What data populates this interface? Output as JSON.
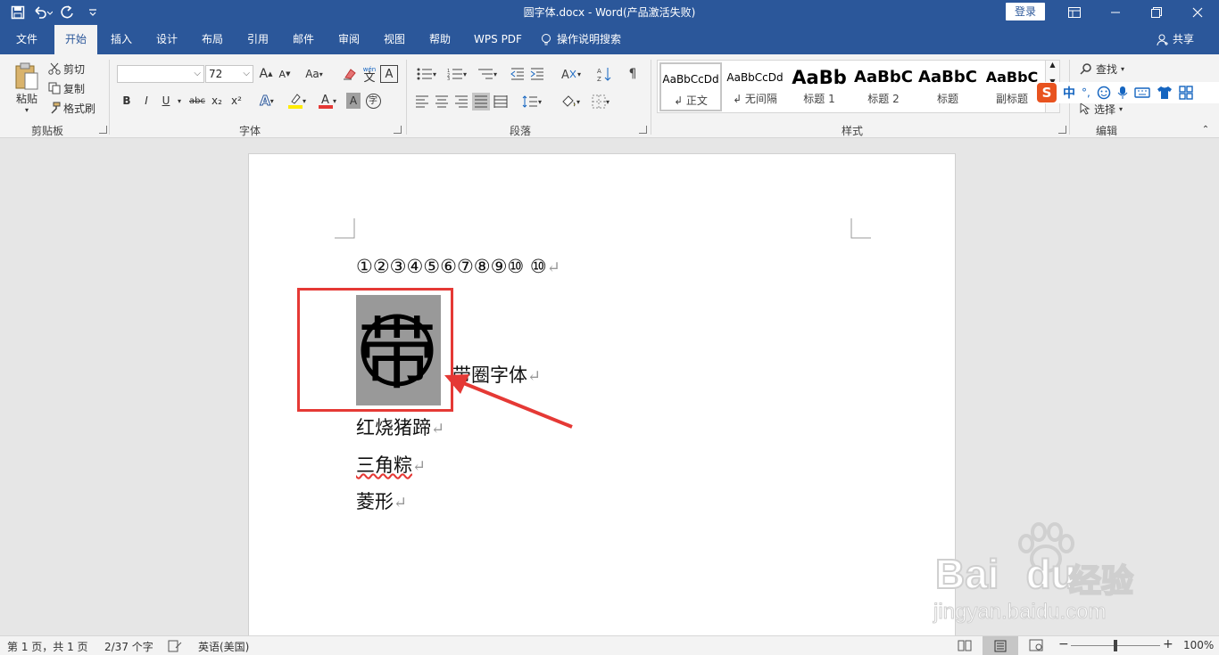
{
  "titlebar": {
    "doc_title": "圆字体.docx  -  Word(产品激活失败)",
    "login": "登录"
  },
  "tabs": [
    "文件",
    "开始",
    "插入",
    "设计",
    "布局",
    "引用",
    "邮件",
    "审阅",
    "视图",
    "帮助",
    "WPS PDF",
    "操作说明搜索"
  ],
  "share": "共享",
  "clipboard": {
    "paste": "粘贴",
    "cut": "剪切",
    "copy": "复制",
    "format_painter": "格式刷",
    "label": "剪贴板"
  },
  "font": {
    "name_value": "",
    "size_value": "72",
    "label": "字体",
    "bold": "B",
    "italic": "I",
    "underline": "U",
    "strike": "abc",
    "sub": "x₂",
    "sup": "x²",
    "wen": "wén",
    "wen_char": "文",
    "case": "Aa",
    "grow": "A",
    "shrink": "A",
    "circle_char": "字"
  },
  "paragraph": {
    "label": "段落"
  },
  "styles": {
    "label": "样式",
    "items": [
      {
        "preview": "AaBbCcDd",
        "name": "↲ 正文"
      },
      {
        "preview": "AaBbCcDd",
        "name": "↲ 无间隔"
      },
      {
        "preview": "AaBb",
        "name": "标题 1"
      },
      {
        "preview": "AaBbC",
        "name": "标题 2"
      },
      {
        "preview": "AaBbC",
        "name": "标题"
      },
      {
        "preview": "AaBbC",
        "name": "副标题"
      }
    ]
  },
  "editing": {
    "find": "查找",
    "select": "选择",
    "label": "编辑"
  },
  "ime": {
    "mode": "中",
    "punct": "°,"
  },
  "document": {
    "line1": "①②③④⑤⑥⑦⑧⑨⑩  ⑩",
    "big_char": "带",
    "line2": "带圈字体",
    "line3": "红烧猪蹄",
    "line4": "三角粽",
    "line5": "菱形",
    "para_mark": "↵"
  },
  "watermark": {
    "brand": "Bai",
    "brand2": "du",
    "cn": "经验",
    "url": "jingyan.baidu.com"
  },
  "statusbar": {
    "page": "第 1 页，共 1 页",
    "words": "2/37 个字",
    "language": "英语(美国)",
    "zoom": "100%"
  },
  "colors": {
    "accent": "#2b579a",
    "highlight_rect": "#e53935",
    "arrow": "#e53935"
  }
}
